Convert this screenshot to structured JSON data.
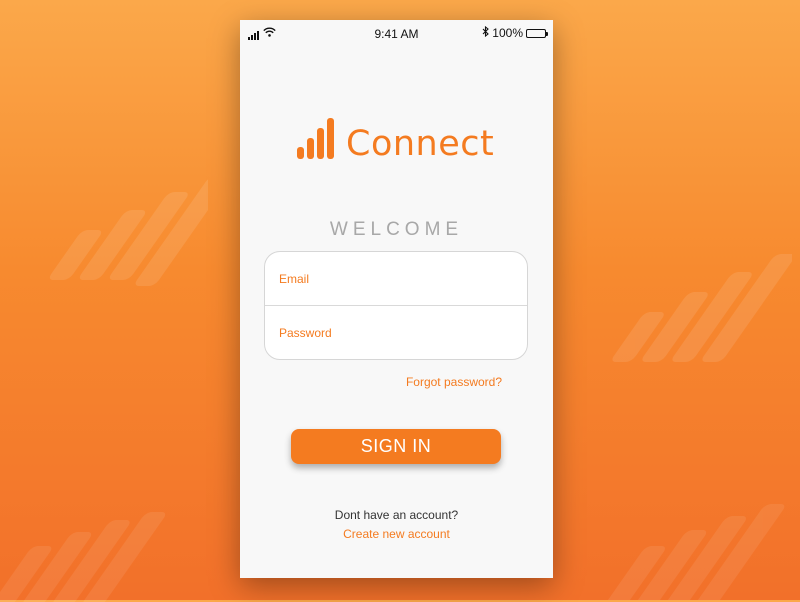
{
  "status_bar": {
    "time": "9:41 AM",
    "battery": "100%"
  },
  "app": {
    "name": "Connect"
  },
  "login": {
    "welcome": "WELCOME",
    "email_placeholder": "Email",
    "password_placeholder": "Password",
    "forgot_label": "Forgot password?",
    "sign_in_label": "SIGN IN",
    "no_account_text": "Dont have an account?",
    "create_account_label": "Create new account"
  },
  "colors": {
    "accent": "#f47b20",
    "background_top": "#fba84a",
    "background_bottom": "#f2702a",
    "muted_text": "#a8a8a8"
  },
  "icons": [
    "signal-icon",
    "wifi-icon",
    "bluetooth-icon",
    "battery-icon",
    "logo-signal-bars-icon"
  ]
}
